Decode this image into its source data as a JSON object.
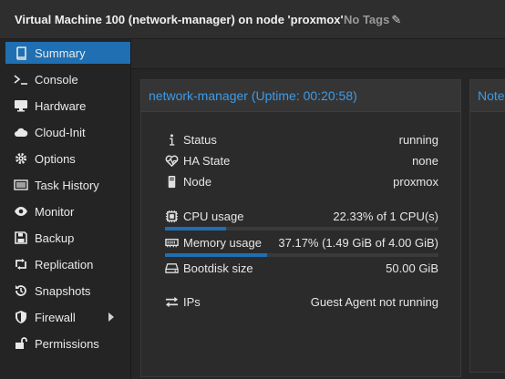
{
  "header": {
    "title": "Virtual Machine 100 (network-manager) on node 'proxmox'",
    "tags_label": "No Tags"
  },
  "sidebar": {
    "items": [
      {
        "label": "Summary",
        "icon": "book-icon",
        "active": true
      },
      {
        "label": "Console",
        "icon": "terminal-icon"
      },
      {
        "label": "Hardware",
        "icon": "monitor-icon"
      },
      {
        "label": "Cloud-Init",
        "icon": "cloud-icon"
      },
      {
        "label": "Options",
        "icon": "gear-icon"
      },
      {
        "label": "Task History",
        "icon": "list-icon"
      },
      {
        "label": "Monitor",
        "icon": "eye-icon"
      },
      {
        "label": "Backup",
        "icon": "floppy-icon"
      },
      {
        "label": "Replication",
        "icon": "retweet-icon"
      },
      {
        "label": "Snapshots",
        "icon": "history-icon"
      },
      {
        "label": "Firewall",
        "icon": "shield-icon",
        "has_submenu": true
      },
      {
        "label": "Permissions",
        "icon": "unlock-icon"
      }
    ]
  },
  "summary": {
    "panel_title": "network-manager (Uptime: 00:20:58)",
    "notes_title": "Note",
    "rows": {
      "status": {
        "label": "Status",
        "value": "running"
      },
      "ha_state": {
        "label": "HA State",
        "value": "none"
      },
      "node": {
        "label": "Node",
        "value": "proxmox"
      },
      "cpu": {
        "label": "CPU usage",
        "value": "22.33% of 1 CPU(s)",
        "percent": 22.33
      },
      "memory": {
        "label": "Memory usage",
        "value": "37.17% (1.49 GiB of 4.00 GiB)",
        "percent": 37.17
      },
      "bootdisk": {
        "label": "Bootdisk size",
        "value": "50.00 GiB"
      },
      "ips": {
        "label": "IPs",
        "value": "Guest Agent not running"
      }
    }
  },
  "colors": {
    "accent": "#1f6fb2",
    "link": "#3d9be9"
  }
}
